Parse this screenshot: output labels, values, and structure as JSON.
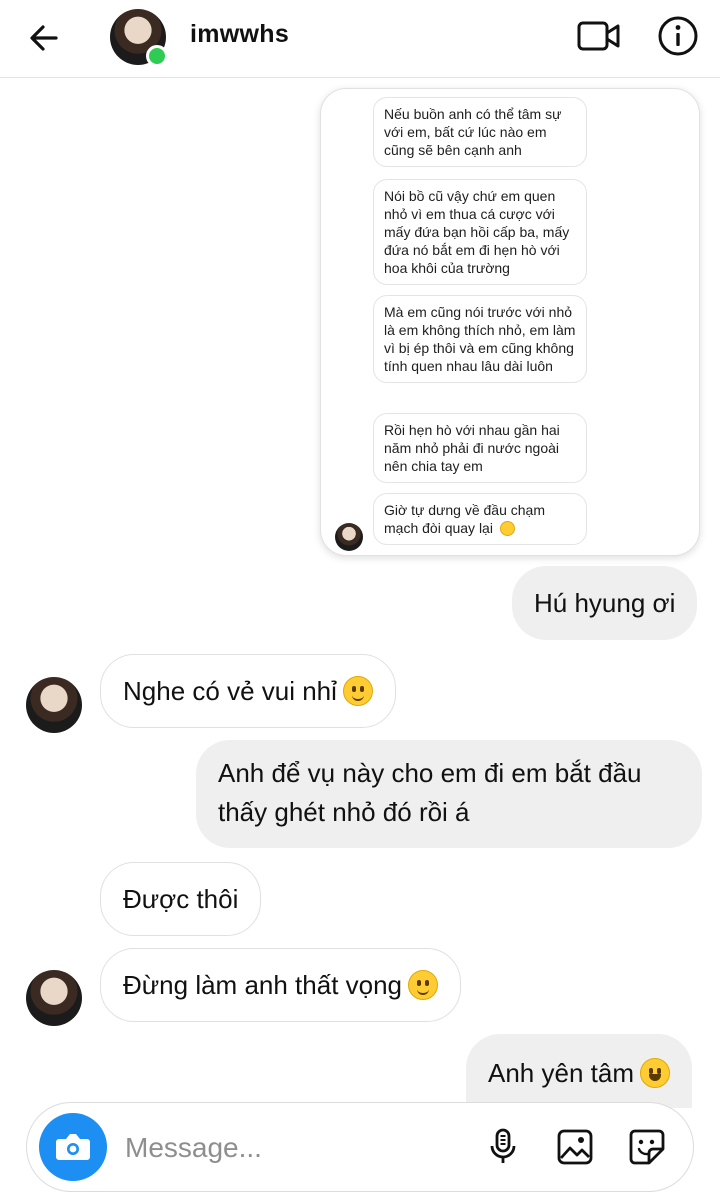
{
  "header": {
    "username": "imwwhs",
    "online": true
  },
  "shared_screenshot": {
    "messages": [
      "Nếu buồn anh có thể tâm sự với em, bất cứ lúc nào em cũng sẽ bên cạnh anh",
      "Nói bồ cũ vậy chứ em quen nhỏ vì em thua cá cược với mấy đứa bạn hồi cấp ba, mấy đứa nó bắt em đi hẹn hò với hoa khôi của trường",
      "Mà em cũng nói trước với nhỏ là em không thích nhỏ, em làm vì bị ép thôi và em cũng không tính quen nhau lâu dài luôn",
      "Rồi hẹn hò với nhau gần hai năm nhỏ phải đi nước ngoài nên chia tay em",
      "Giờ tự dưng về đầu chạm mạch đòi quay lại"
    ]
  },
  "chat": [
    {
      "side": "out",
      "text": "Hú hyung ơi"
    },
    {
      "side": "in",
      "text": "Nghe có vẻ vui nhỉ",
      "emoji": "slight-smile"
    },
    {
      "side": "out",
      "text": "Anh để vụ này cho em đi em bắt đầu thấy ghét nhỏ đó rồi á"
    },
    {
      "side": "in",
      "text": "Được thôi"
    },
    {
      "side": "in",
      "text": "Đừng làm anh thất vọng",
      "emoji": "smiling-eyes"
    },
    {
      "side": "out",
      "text": "Anh yên tâm",
      "emoji": "grin"
    }
  ],
  "composer": {
    "placeholder": "Message..."
  },
  "colors": {
    "accent": "#1d8ff2",
    "online": "#2ecc52",
    "outgoing_bubble": "#efefef"
  }
}
